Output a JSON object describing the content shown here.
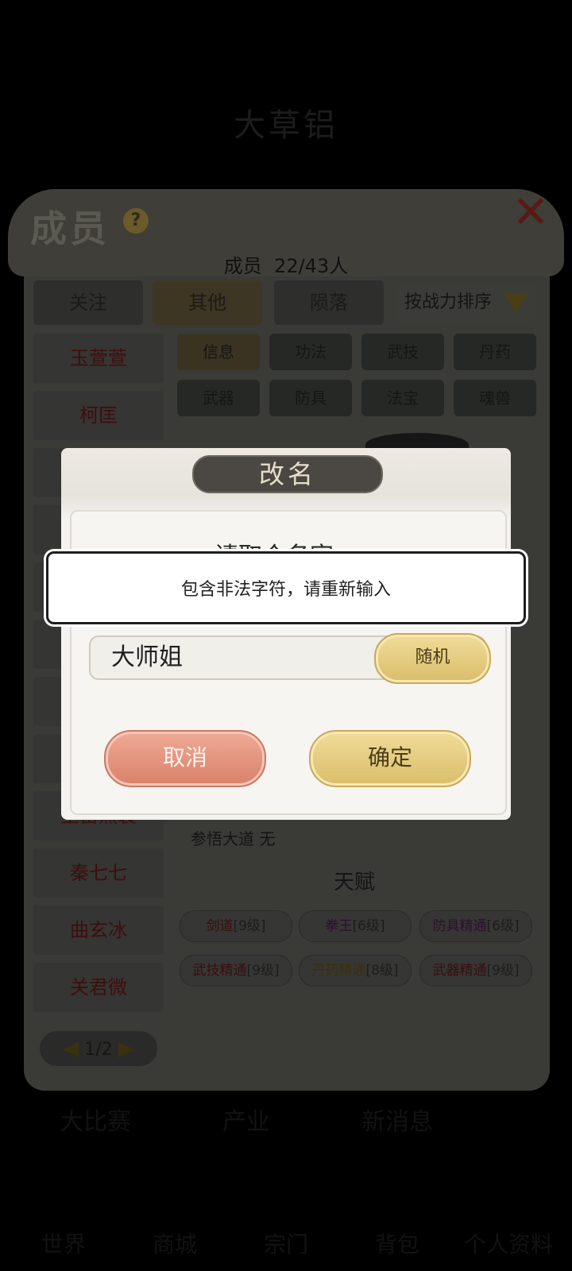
{
  "background": {
    "top_title": "大草铝",
    "panel_title": "成员",
    "member_count_label": "成员",
    "member_count": "22/43人",
    "filter_tabs": [
      "关注",
      "其他",
      "陨落"
    ],
    "sort_label": "按战力排序",
    "detail_tabs": [
      "信息",
      "功法",
      "武技",
      "丹药",
      "武器",
      "防具",
      "法宝",
      "魂兽"
    ],
    "members": [
      "玉萱萱",
      "柯匡",
      "",
      "",
      "",
      "",
      "",
      "",
      "",
      "王苗然蓑",
      "秦七七",
      "曲玄冰",
      "关君微"
    ],
    "dao_label": "参悟大道 无",
    "talent_title": "天赋",
    "talents": [
      {
        "name": "剑道",
        "level": "[9级]"
      },
      {
        "name": "拳王",
        "level": "[6级]"
      },
      {
        "name": "防具精通",
        "level": "[6级]"
      },
      {
        "name": "武技精通",
        "level": "[9级]"
      },
      {
        "name": "丹药精通",
        "level": "[8级]"
      },
      {
        "name": "武器精通",
        "level": "[9级]"
      }
    ],
    "pager": "1/2",
    "bottom_tabs": [
      "大比赛",
      "产业",
      "新消息"
    ],
    "bottom_nav": [
      "世界",
      "商城",
      "宗门",
      "背包",
      "个人资料"
    ]
  },
  "dialog": {
    "title": "改名",
    "prompt": "请取个名字",
    "name_value": "大师姐",
    "random_label": "随机",
    "cancel_label": "取消",
    "confirm_label": "确定"
  },
  "toast": {
    "message": "包含非法字符，请重新输入"
  }
}
